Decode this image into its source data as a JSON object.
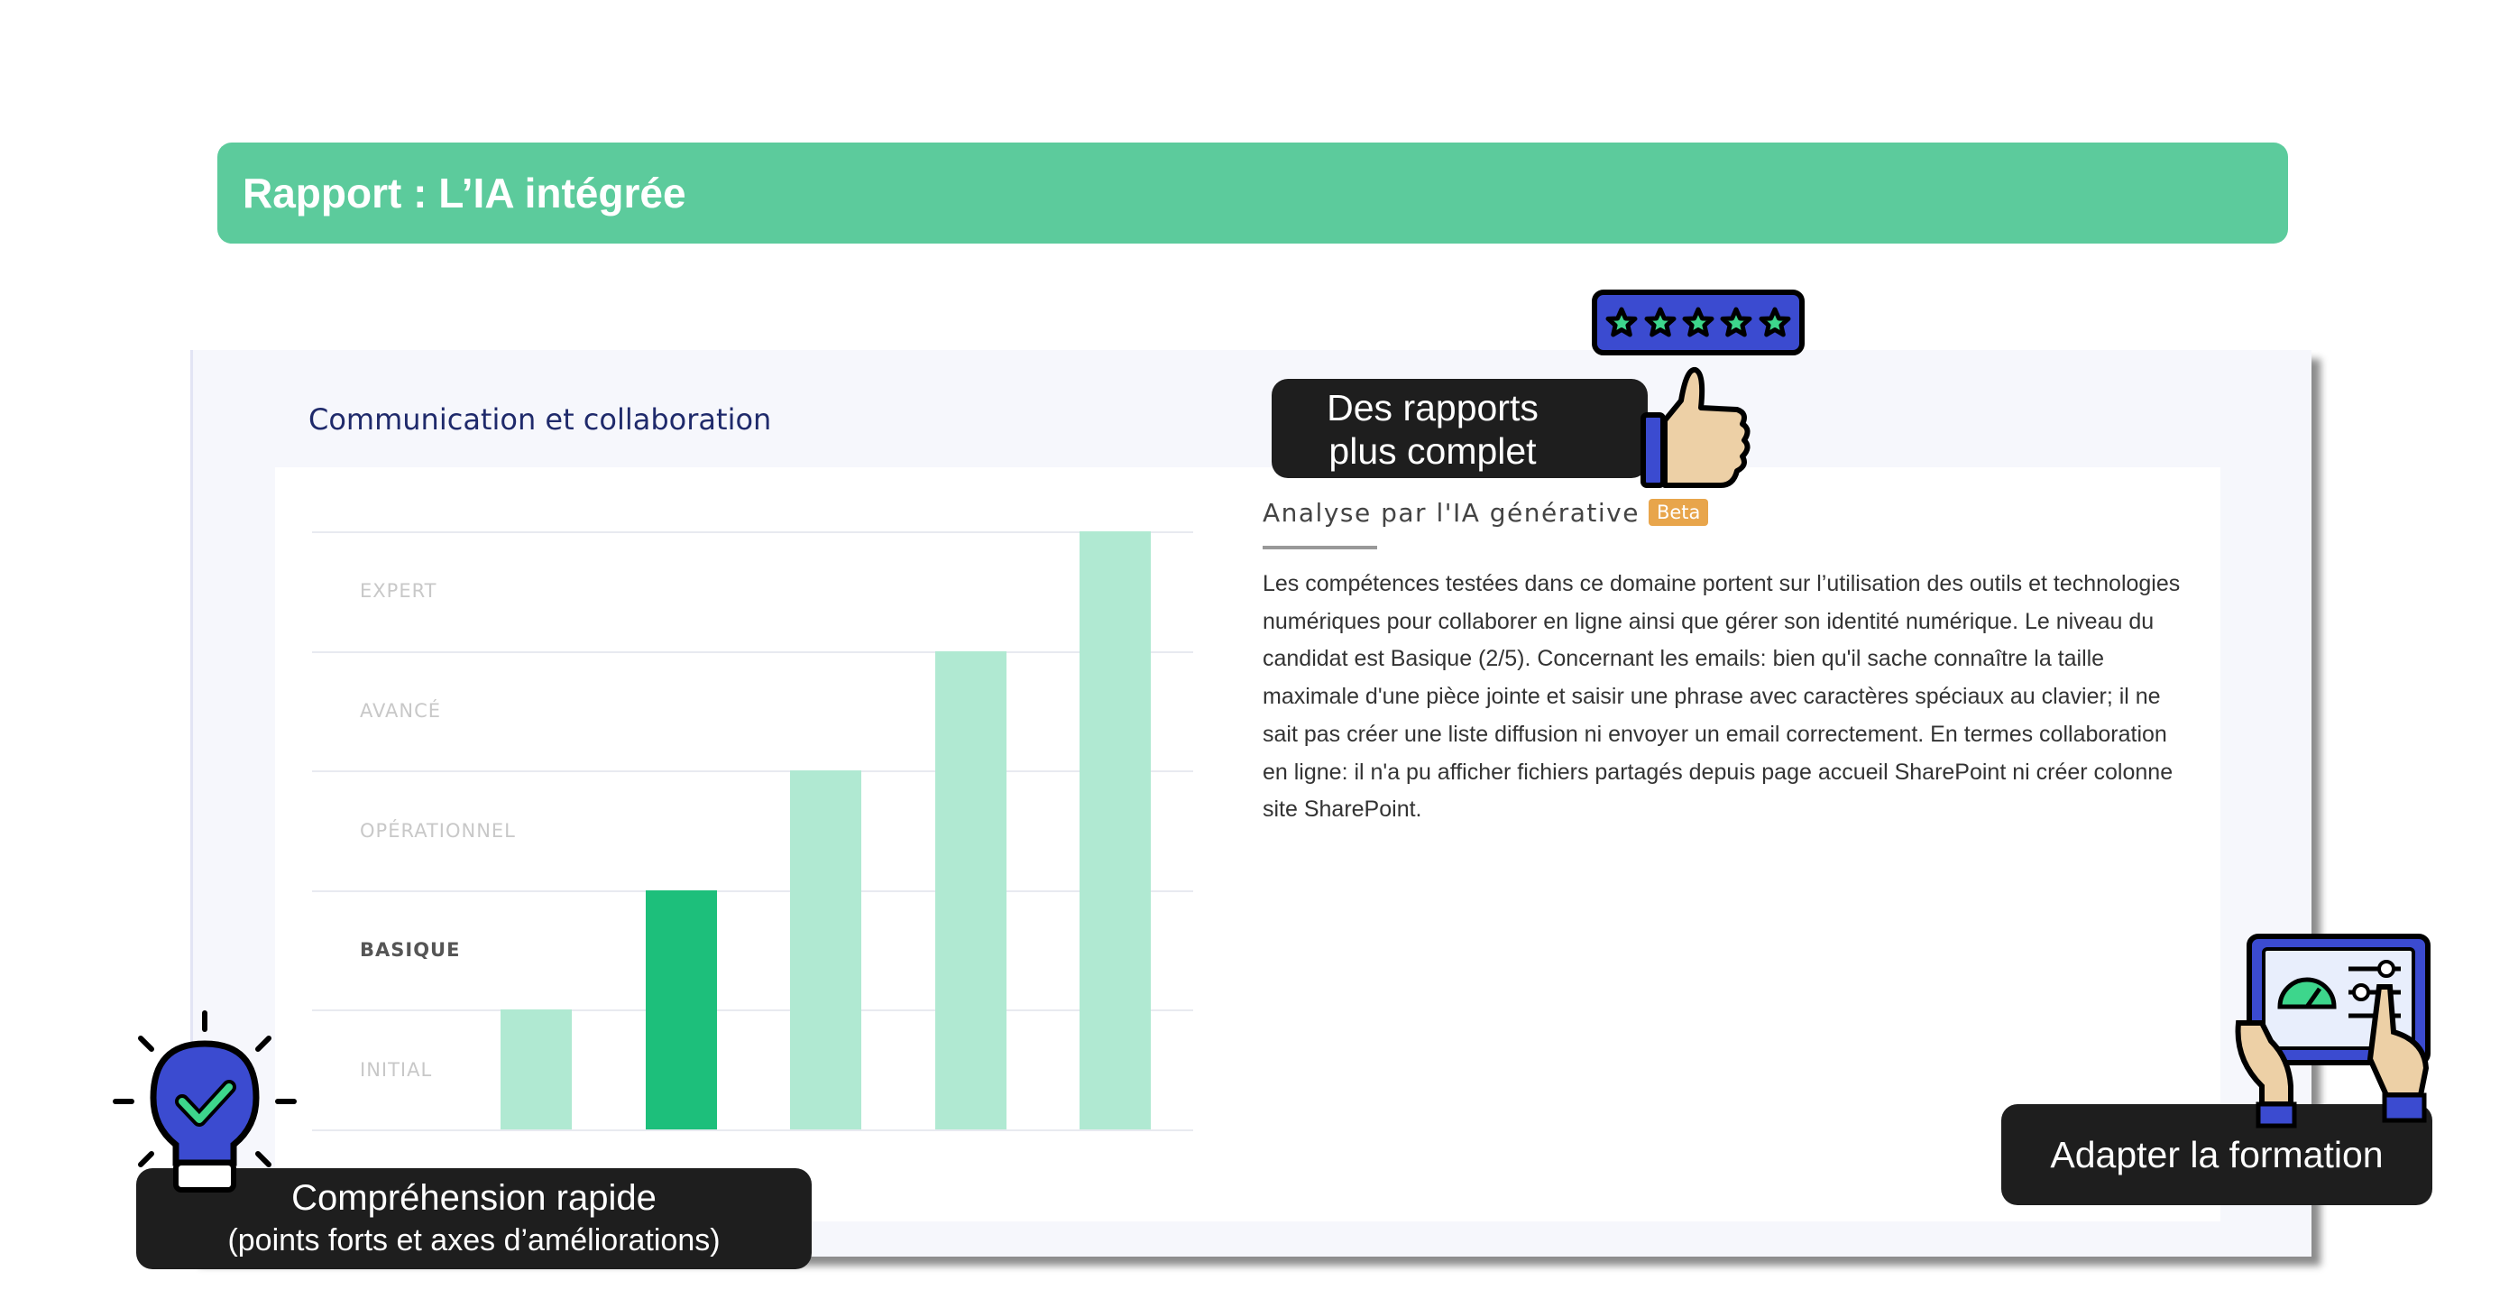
{
  "header": {
    "title": "Rapport : L’IA intégrée",
    "color": "#5ccb9c"
  },
  "card": {
    "title": "Communication et collaboration"
  },
  "chart_data": {
    "type": "bar",
    "ylabels": [
      "INITIAL",
      "BASIQUE",
      "OPÉRATIONNEL",
      "AVANCÉ",
      "EXPERT"
    ],
    "values": [
      1,
      2,
      3,
      4,
      5
    ],
    "highlight_index": 1,
    "highlight_label": "BASIQUE",
    "ylim": [
      0,
      5
    ],
    "grid": true,
    "colors": {
      "bar": "#b0e9d2",
      "highlight": "#1dbf7b"
    }
  },
  "analysis": {
    "title": "Analyse par l'IA générative",
    "badge": "Beta",
    "badge_color": "#e8a54b",
    "text": "Les compétences testées dans ce domaine portent sur l’utilisation des outils et technologies numériques pour collaborer en ligne ainsi que gérer son identité numérique. Le niveau du candidat est Basique (2/5). Concernant les emails: bien qu'il sache connaître la taille maximale d'une pièce jointe et saisir une phrase avec caractères spéciaux au clavier; il ne sait pas créer une liste diffusion ni envoyer un email correctement. En termes collaboration en ligne: il n'a pu afficher fichiers partagés depuis page accueil SharePoint ni créer colonne site SharePoint."
  },
  "callouts": {
    "reports_line1": "Des rapports",
    "reports_line2": "plus complet",
    "understanding_line1": "Compréhension rapide",
    "understanding_line2": "(points forts et axes d’améliorations)",
    "adapt": "Adapter la formation"
  },
  "icons": {
    "rating": "five-star-rating-icon",
    "thumb": "thumbs-up-icon",
    "bulb": "lightbulb-check-icon",
    "dashboard": "tablet-dashboard-icon"
  }
}
